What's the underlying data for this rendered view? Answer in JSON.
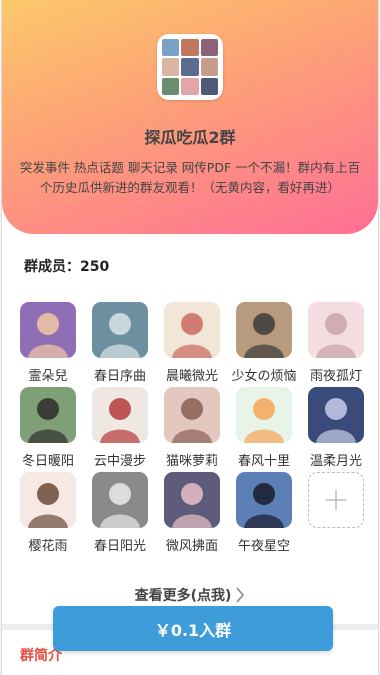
{
  "group": {
    "title": "探瓜吃瓜2群",
    "description": "突发事件 热点话题 聊天记录 网传PDF 一个不漏！群内有上百个历史瓜供新进的群友观看！（无黄内容，看好再进）"
  },
  "members": {
    "label": "群成员：250",
    "list": [
      {
        "name": "霊朵兒",
        "bg": "#8e6fb6",
        "fg": "#f3c9a4"
      },
      {
        "name": "春日序曲",
        "bg": "#6d8fa0",
        "fg": "#d9e4e8"
      },
      {
        "name": "晨曦微光",
        "bg": "#f2e6d8",
        "fg": "#c96a5e"
      },
      {
        "name": "少女の烦恼",
        "bg": "#b89a7f",
        "fg": "#3b3b3b"
      },
      {
        "name": "雨夜孤灯",
        "bg": "#f4dde1",
        "fg": "#caa3a7"
      },
      {
        "name": "冬日暖阳",
        "bg": "#7fa076",
        "fg": "#2d2d2d"
      },
      {
        "name": "云中漫步",
        "bg": "#efe7e2",
        "fg": "#b33a3a"
      },
      {
        "name": "猫咪萝莉",
        "bg": "#e4c7bf",
        "fg": "#8c5f52"
      },
      {
        "name": "春风十里",
        "bg": "#e8f4e8",
        "fg": "#f3a45a"
      },
      {
        "name": "温柔月光",
        "bg": "#3a4a7a",
        "fg": "#c7cfe8"
      },
      {
        "name": "樱花雨",
        "bg": "#f6e9e4",
        "fg": "#6b4a3a"
      },
      {
        "name": "春日阳光",
        "bg": "#8a8a8a",
        "fg": "#eaeaea"
      },
      {
        "name": "微风拂面",
        "bg": "#5d5a7a",
        "fg": "#e8c0c6"
      },
      {
        "name": "午夜星空",
        "bg": "#5c7fb5",
        "fg": "#1a1a2e"
      }
    ]
  },
  "more_label": "查看更多(点我)",
  "intro_label": "群简介",
  "join_label": "￥0.1入群",
  "colors": {
    "hero_start": "#fcc96a",
    "hero_end": "#ff6f96",
    "join_button": "#3f9cdb",
    "intro_accent": "#e74c3c"
  }
}
